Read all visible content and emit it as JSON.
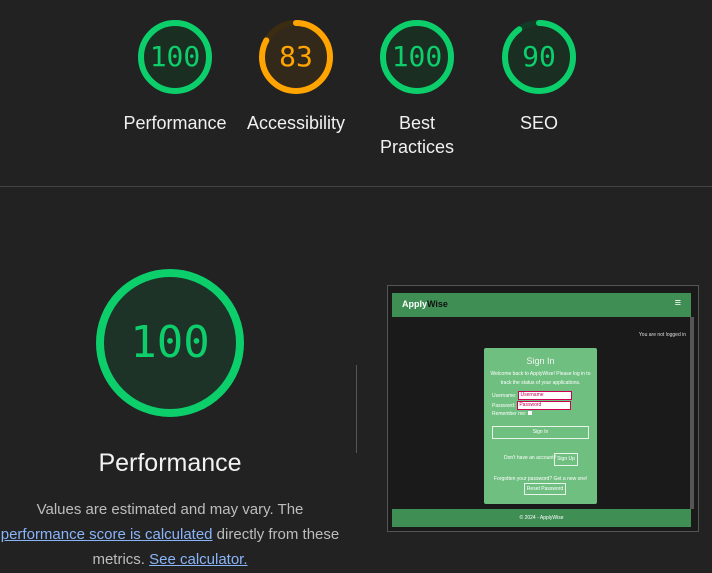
{
  "summary": [
    {
      "id": "performance",
      "score": "100",
      "value": 100,
      "label": "Performance",
      "color": "#0cce6b",
      "track": "#123a24"
    },
    {
      "id": "accessibility",
      "score": "83",
      "value": 83,
      "label": "Accessibility",
      "color": "#ffa400",
      "track": "#3b2c12"
    },
    {
      "id": "best-practices",
      "score": "100",
      "value": 100,
      "label": "Best Practices",
      "color": "#0cce6b",
      "track": "#123a24"
    },
    {
      "id": "seo",
      "score": "90",
      "value": 90,
      "label": "SEO",
      "color": "#0cce6b",
      "track": "#123a24"
    }
  ],
  "detail": {
    "score": "100",
    "value": 100,
    "title": "Performance",
    "desc_before": "Values are estimated and may vary. The ",
    "desc_link": "performance score is calculated",
    "desc_middle": " directly from these metrics. ",
    "desc_link2": "See calculator."
  },
  "preview": {
    "brand_a": "Apply",
    "brand_b": "Wise",
    "menu": "≡",
    "status": "You are not logged in",
    "card_title": "Sign In",
    "welcome": "Welcome back to ApplyWise! Please log in to track the status of your applications.",
    "username_label": "Username:",
    "username_placeholder": "Username",
    "password_label": "Password:",
    "password_placeholder": "Password",
    "remember": "Remember me:",
    "signin": "Sign In",
    "no_account": "Don't have an account?",
    "signup": "Sign Up",
    "forgot": "Forgotten your password? Get a new one!",
    "reset": "Reset Password",
    "footer": "© 2024 - ApplyWise"
  }
}
